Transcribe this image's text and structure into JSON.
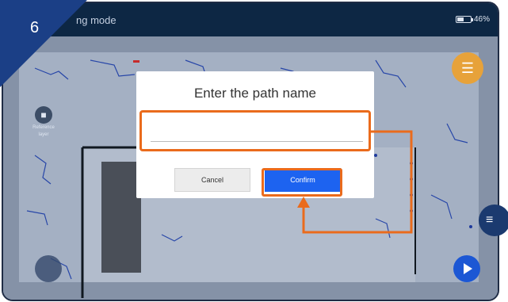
{
  "step_badge": {
    "number": "6"
  },
  "statusbar": {
    "mode_text": "ng mode",
    "battery_text": "46%"
  },
  "reference_layer": {
    "label_line1": "Reference",
    "label_line2": "layer"
  },
  "dialog": {
    "title": "Enter the path name",
    "input_value": "",
    "input_placeholder": "",
    "cancel_label": "Cancel",
    "confirm_label": "Confirm"
  },
  "icons": {
    "book": "book-icon",
    "menu": "menu-icon",
    "play": "play-icon",
    "layers": "layers-icon"
  },
  "colors": {
    "highlight": "#ea6b1c",
    "confirm_button": "#1d63f0",
    "badge": "#1b3f86",
    "book_button": "#e7a23a"
  }
}
